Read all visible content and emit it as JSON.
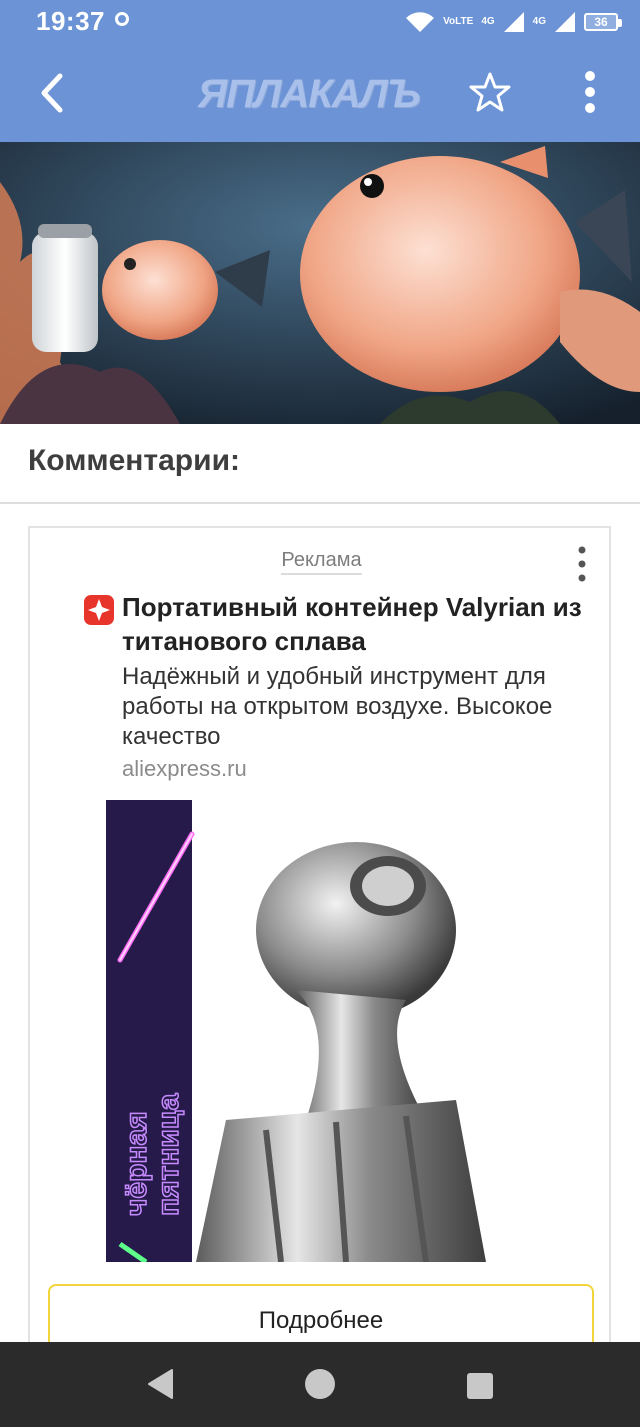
{
  "status": {
    "time": "19:37",
    "network1": "4G",
    "network2": "4G",
    "volte": "VoLTE",
    "battery": "36"
  },
  "appbar": {
    "logo": "ЯПЛАКАЛЪ"
  },
  "comments": {
    "title": "Комментарии:"
  },
  "ad": {
    "label": "Реклама",
    "title": "Портативный контейнер Valyrian из титанового сплава",
    "description": "Надёжный и удобный инструмент для работы на открытом воздухе. Высокое качество",
    "domain": "aliexpress.ru",
    "promo_line1": "чёрная",
    "promo_line2": "пятница",
    "button_label": "Подробнее"
  },
  "colors": {
    "header": "#6b93d6",
    "button_border": "#f2d43b",
    "navbar": "#2b2b2b"
  }
}
